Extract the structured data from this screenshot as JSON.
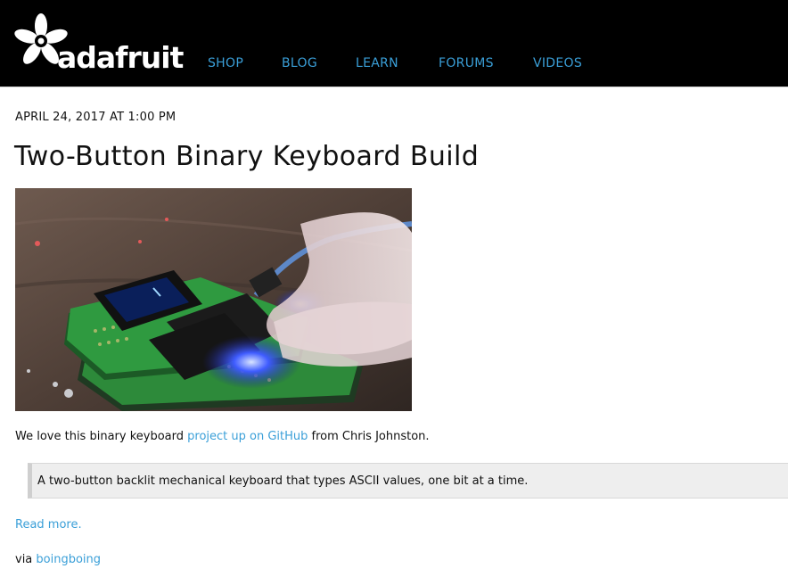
{
  "header": {
    "logo_text": "adafruit",
    "nav": [
      {
        "label": "SHOP"
      },
      {
        "label": "BLOG"
      },
      {
        "label": "LEARN"
      },
      {
        "label": "FORUMS"
      },
      {
        "label": "VIDEOS"
      }
    ],
    "colors": {
      "background": "#000000",
      "link": "#3a9fd8"
    }
  },
  "post": {
    "date": "APRIL 24, 2017 AT 1:00 PM",
    "title": "Two-Button Binary Keyboard Build",
    "intro_before": "We love this binary keyboard ",
    "intro_link": "project up on GitHub",
    "intro_after": " from Chris Johnston.",
    "quote": "A two-button backlit mechanical keyboard that types ASCII values, one bit at a time.",
    "read_more": "Read more.",
    "via_prefix": "via ",
    "via_link": "boingboing"
  }
}
